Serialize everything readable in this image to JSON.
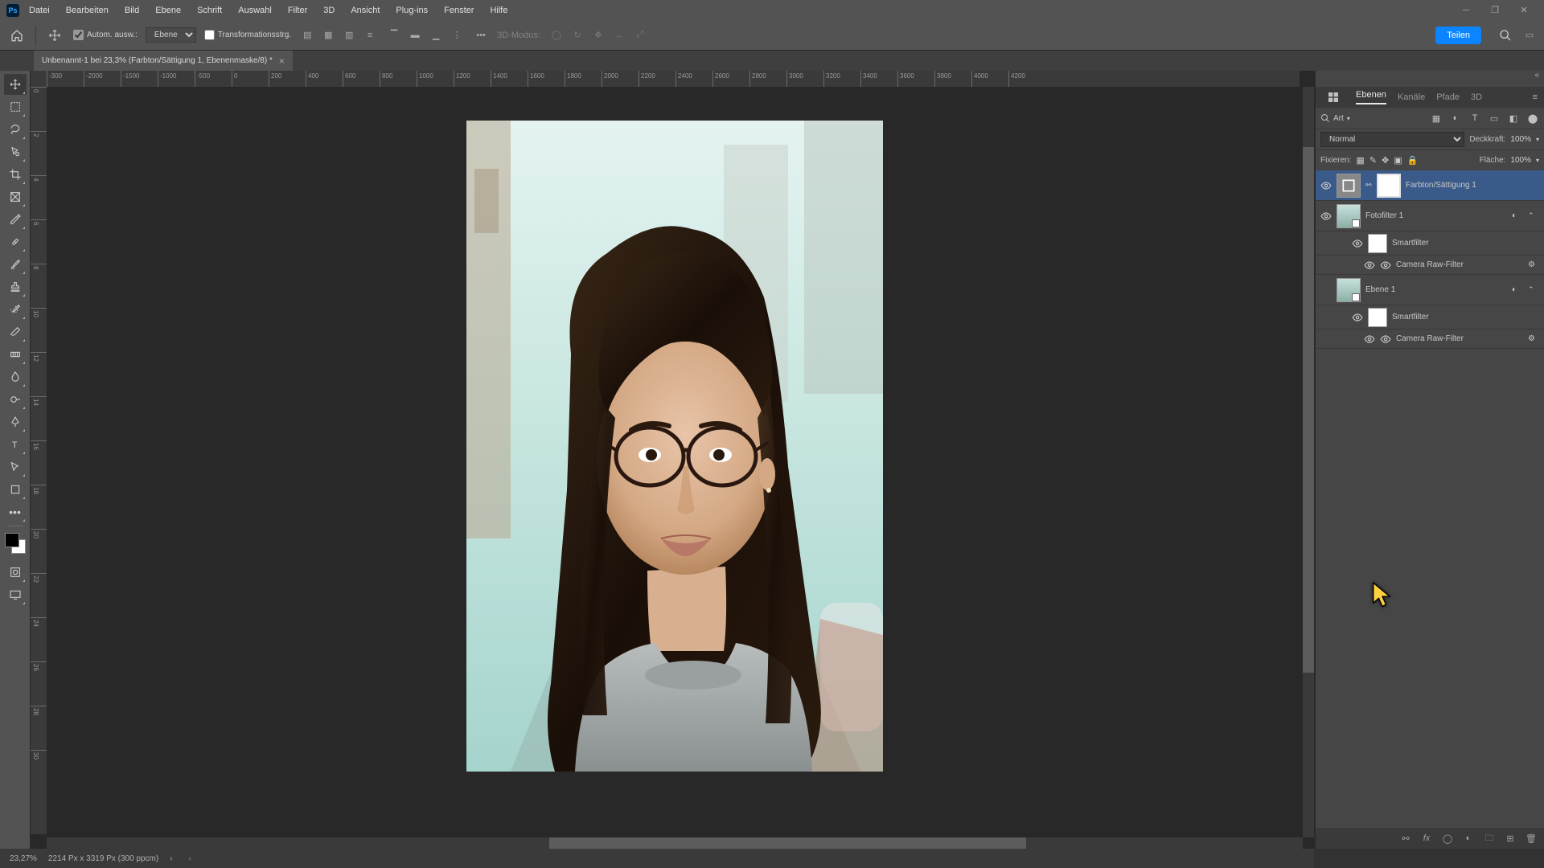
{
  "menu": {
    "items": [
      "Datei",
      "Bearbeiten",
      "Bild",
      "Ebene",
      "Schrift",
      "Auswahl",
      "Filter",
      "3D",
      "Ansicht",
      "Plug-ins",
      "Fenster",
      "Hilfe"
    ]
  },
  "options": {
    "auto_select": "Autom. ausw.:",
    "select_target": "Ebene",
    "transform": "Transformationsstrg.",
    "mode_3d": "3D-Modus:",
    "share": "Teilen"
  },
  "tab": {
    "title": "Unbenannt-1 bei 23,3% (Farbton/Sättigung 1, Ebenenmaske/8) *"
  },
  "ruler_h": [
    "-300",
    "-2000",
    "-1500",
    "-1000",
    "-500",
    "0",
    "200",
    "400",
    "600",
    "800",
    "1000",
    "1200",
    "1400",
    "1600",
    "1800",
    "2000",
    "2200",
    "2400",
    "2600",
    "2800",
    "3000",
    "3200",
    "3400",
    "3600",
    "3800",
    "4000",
    "4200"
  ],
  "ruler_v": [
    "0",
    "2",
    "4",
    "6",
    "8",
    "10",
    "12",
    "14",
    "16",
    "18",
    "20",
    "22",
    "24",
    "26",
    "28",
    "30"
  ],
  "panels": {
    "tabs": [
      "Ebenen",
      "Kanäle",
      "Pfade",
      "3D"
    ],
    "search_label": "Art",
    "blend_mode": "Normal",
    "opacity_label": "Deckkraft:",
    "opacity_value": "100%",
    "lock_label": "Fixieren:",
    "fill_label": "Fläche:",
    "fill_value": "100%"
  },
  "layers": [
    {
      "name": "Farbton/Sättigung 1",
      "type": "adjustment",
      "visible": true,
      "selected": true
    },
    {
      "name": "Fotofilter 1",
      "type": "smart",
      "visible": true
    },
    {
      "name": "Smartfilter",
      "type": "sf",
      "visible": true
    },
    {
      "name": "Camera Raw-Filter",
      "type": "filter",
      "visible": true
    },
    {
      "name": "Ebene 1",
      "type": "smart",
      "visible": false
    },
    {
      "name": "Smartfilter",
      "type": "sf",
      "visible": true
    },
    {
      "name": "Camera Raw-Filter",
      "type": "filter",
      "visible": true
    }
  ],
  "status": {
    "zoom": "23,27%",
    "doc": "2214 Px x 3319 Px (300 ppcm)"
  }
}
